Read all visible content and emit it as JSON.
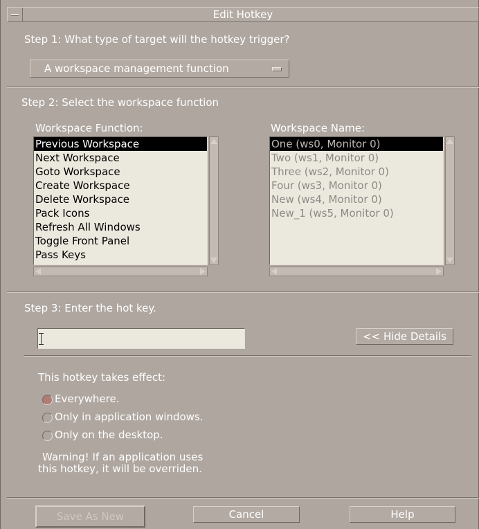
{
  "window": {
    "title": "Edit Hotkey"
  },
  "step1": {
    "label": "Step 1: What type of target will the hotkey trigger?",
    "selected": "A workspace management function"
  },
  "step2": {
    "label": "Step 2: Select the workspace function",
    "function_label": "Workspace Function:",
    "functions": [
      "Previous Workspace",
      "Next Workspace",
      "Goto Workspace",
      "Create Workspace",
      "Delete Workspace",
      "Pack Icons",
      "Refresh All Windows",
      "Toggle Front Panel",
      "Pass Keys"
    ],
    "name_label": "Workspace Name:",
    "names": [
      "One (ws0, Monitor 0)",
      "Two (ws1, Monitor 0)",
      "Three (ws2, Monitor 0)",
      "Four (ws3, Monitor 0)",
      "New (ws4, Monitor 0)",
      "New_1 (ws5, Monitor 0)"
    ]
  },
  "step3": {
    "label": "Step 3: Enter the hot key.",
    "value": "",
    "details_button": "<< Hide Details"
  },
  "scope": {
    "label": "This hotkey takes effect:",
    "options": [
      "Everywhere.",
      "Only in application windows.",
      "Only on the desktop."
    ],
    "selected_index": 0,
    "warning_line1": "Warning! If an application uses",
    "warning_line2": "this hotkey, it will be overriden."
  },
  "buttons": {
    "save_as_new": "Save As New",
    "cancel": "Cancel",
    "help": "Help"
  },
  "colors": {
    "background": "#aea69f",
    "list_background": "#ebe8de",
    "selection": "#000000",
    "radio_selected": "#b07c74"
  }
}
